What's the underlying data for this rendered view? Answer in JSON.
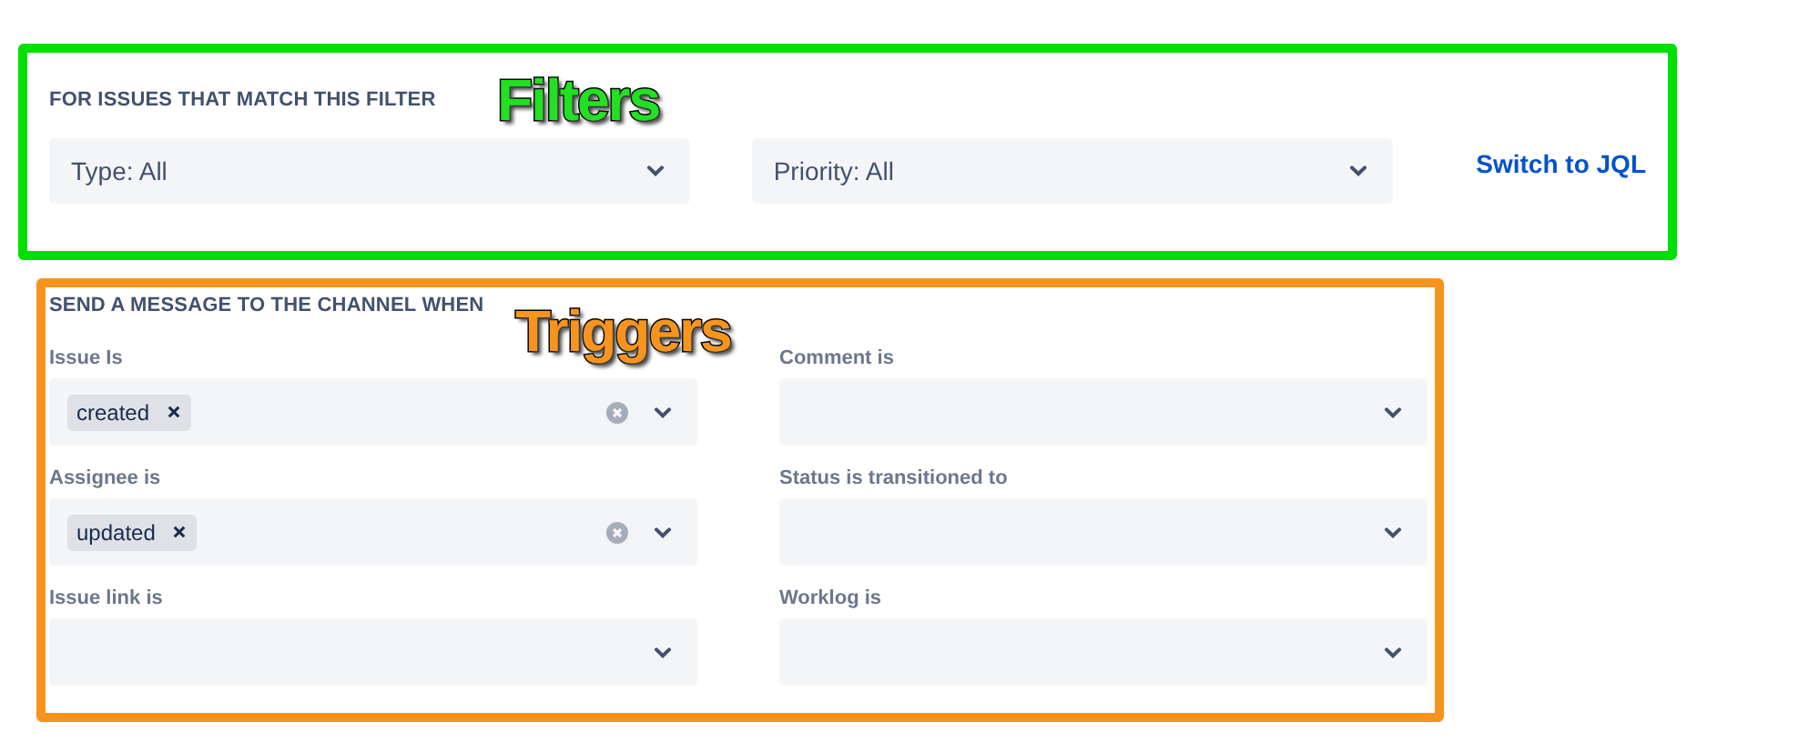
{
  "filters": {
    "callout": "Filters",
    "heading": "FOR ISSUES THAT MATCH THIS FILTER",
    "selects": [
      {
        "value": "Type: All"
      },
      {
        "value": "Priority: All"
      }
    ],
    "link": "Switch to JQL"
  },
  "triggers": {
    "callout": "Triggers",
    "heading": "SEND A MESSAGE TO THE CHANNEL WHEN",
    "fields": [
      {
        "label": "Issue Is",
        "tags": [
          "created"
        ]
      },
      {
        "label": "Comment is"
      },
      {
        "label": "Assignee is",
        "tags": [
          "updated"
        ]
      },
      {
        "label": "Status is transitioned to"
      },
      {
        "label": "Issue link is"
      },
      {
        "label": "Worklog is"
      }
    ]
  }
}
